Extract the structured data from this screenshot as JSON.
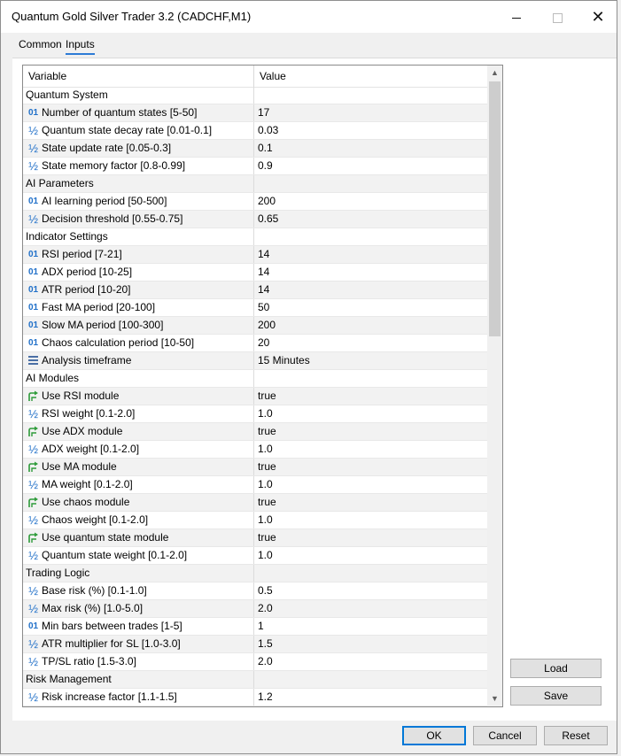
{
  "window": {
    "title": "Quantum Gold Silver Trader 3.2 (CADCHF,M1)",
    "controls": {
      "minimize_icon": "minimize-icon",
      "maximize_icon": "maximize-icon",
      "close_symbol": "✕"
    }
  },
  "tabs": [
    {
      "label": "Common",
      "selected": false
    },
    {
      "label": "Inputs",
      "selected": true
    }
  ],
  "grid": {
    "headers": {
      "variable": "Variable",
      "value": "Value"
    },
    "rows": [
      {
        "type": "group",
        "label": "Quantum System",
        "value": ""
      },
      {
        "type": "int",
        "icon": "01",
        "label": "Number of quantum states [5-50]",
        "value": "17"
      },
      {
        "type": "double",
        "icon": "½",
        "label": "Quantum state decay rate [0.01-0.1]",
        "value": "0.03"
      },
      {
        "type": "double",
        "icon": "½",
        "label": "State update rate [0.05-0.3]",
        "value": "0.1"
      },
      {
        "type": "double",
        "icon": "½",
        "label": "State memory factor [0.8-0.99]",
        "value": "0.9"
      },
      {
        "type": "group",
        "label": "AI Parameters",
        "value": ""
      },
      {
        "type": "int",
        "icon": "01",
        "label": "AI learning period [50-500]",
        "value": "200"
      },
      {
        "type": "double",
        "icon": "½",
        "label": "Decision threshold [0.55-0.75]",
        "value": "0.65"
      },
      {
        "type": "group",
        "label": "Indicator Settings",
        "value": ""
      },
      {
        "type": "int",
        "icon": "01",
        "label": "RSI period [7-21]",
        "value": "14"
      },
      {
        "type": "int",
        "icon": "01",
        "label": "ADX period [10-25]",
        "value": "14"
      },
      {
        "type": "int",
        "icon": "01",
        "label": "ATR period [10-20]",
        "value": "14"
      },
      {
        "type": "int",
        "icon": "01",
        "label": "Fast MA period [20-100]",
        "value": "50"
      },
      {
        "type": "int",
        "icon": "01",
        "label": "Slow MA period [100-300]",
        "value": "200"
      },
      {
        "type": "int",
        "icon": "01",
        "label": "Chaos calculation period [10-50]",
        "value": "20"
      },
      {
        "type": "enum",
        "icon": "",
        "label": "Analysis timeframe",
        "value": "15 Minutes"
      },
      {
        "type": "group",
        "label": "AI Modules",
        "value": ""
      },
      {
        "type": "bool",
        "icon": "",
        "label": "Use RSI module",
        "value": "true"
      },
      {
        "type": "double",
        "icon": "½",
        "label": "RSI weight [0.1-2.0]",
        "value": "1.0"
      },
      {
        "type": "bool",
        "icon": "",
        "label": "Use ADX module",
        "value": "true"
      },
      {
        "type": "double",
        "icon": "½",
        "label": "ADX weight [0.1-2.0]",
        "value": "1.0"
      },
      {
        "type": "bool",
        "icon": "",
        "label": "Use MA module",
        "value": "true"
      },
      {
        "type": "double",
        "icon": "½",
        "label": "MA weight [0.1-2.0]",
        "value": "1.0"
      },
      {
        "type": "bool",
        "icon": "",
        "label": "Use chaos module",
        "value": "true"
      },
      {
        "type": "double",
        "icon": "½",
        "label": "Chaos weight [0.1-2.0]",
        "value": "1.0"
      },
      {
        "type": "bool",
        "icon": "",
        "label": "Use quantum state module",
        "value": "true"
      },
      {
        "type": "double",
        "icon": "½",
        "label": "Quantum state weight [0.1-2.0]",
        "value": "1.0"
      },
      {
        "type": "group",
        "label": "Trading Logic",
        "value": ""
      },
      {
        "type": "double",
        "icon": "½",
        "label": "Base risk (%) [0.1-1.0]",
        "value": "0.5"
      },
      {
        "type": "double",
        "icon": "½",
        "label": "Max risk (%) [1.0-5.0]",
        "value": "2.0"
      },
      {
        "type": "int",
        "icon": "01",
        "label": "Min bars between trades [1-5]",
        "value": "1"
      },
      {
        "type": "double",
        "icon": "½",
        "label": "ATR multiplier for SL [1.0-3.0]",
        "value": "1.5"
      },
      {
        "type": "double",
        "icon": "½",
        "label": "TP/SL ratio [1.5-3.0]",
        "value": "2.0"
      },
      {
        "type": "group",
        "label": "Risk Management",
        "value": ""
      },
      {
        "type": "double",
        "icon": "½",
        "label": "Risk increase factor [1.1-1.5]",
        "value": "1.2"
      }
    ]
  },
  "scrollbar": {
    "up_symbol": "▲",
    "down_symbol": "▼"
  },
  "buttons": {
    "load": "Load",
    "save": "Save",
    "ok": "OK",
    "cancel": "Cancel",
    "reset": "Reset"
  },
  "colors": {
    "icon_blue": "#1f6fc8",
    "bool_green": "#2e9b3a",
    "tab_accent": "#2c7bd6",
    "ok_border": "#0078d7"
  }
}
